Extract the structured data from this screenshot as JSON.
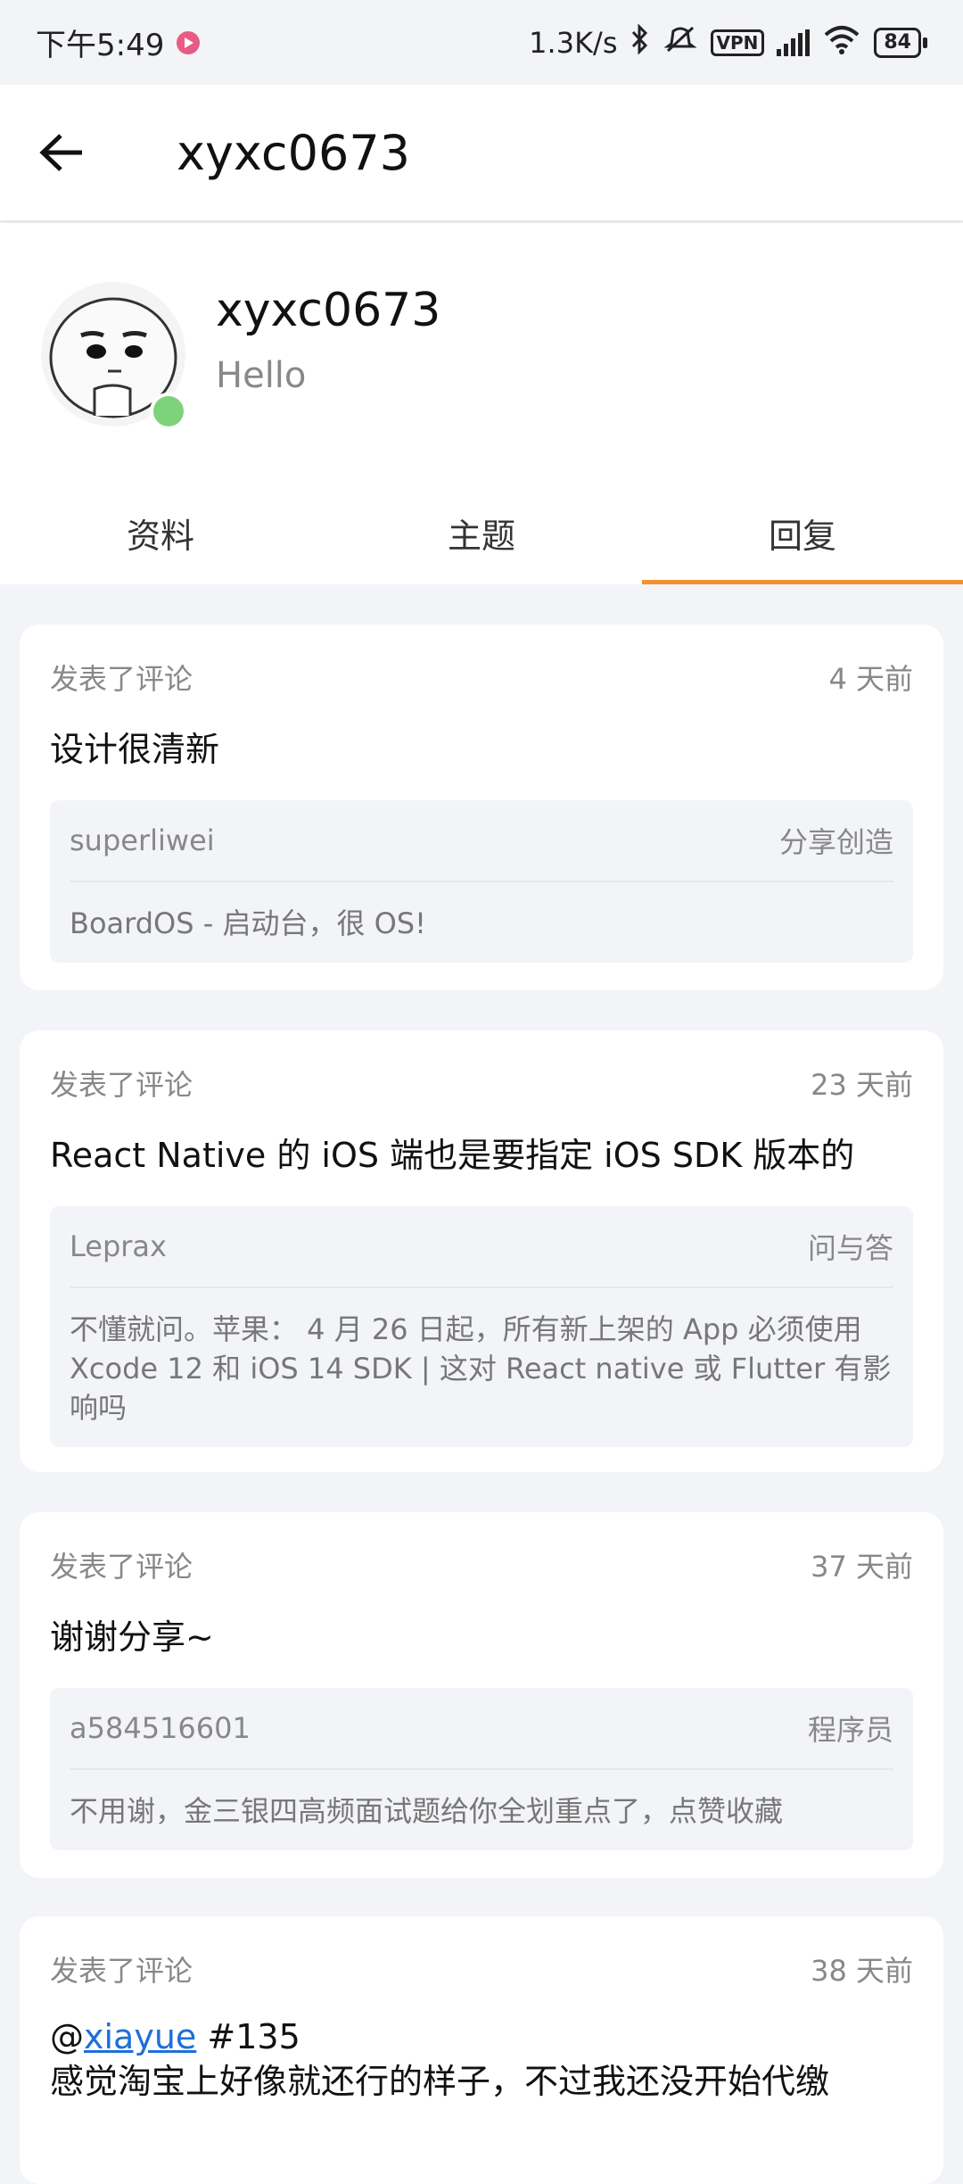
{
  "status_bar": {
    "time": "下午5:49",
    "speed": "1.3K/s",
    "vpn": "VPN",
    "battery": "84"
  },
  "app_bar": {
    "title": "xyxc0673"
  },
  "profile": {
    "username": "xyxc0673",
    "bio": "Hello",
    "online_color": "#7ed37a"
  },
  "tabs": [
    {
      "label": "资料",
      "active": false
    },
    {
      "label": "主题",
      "active": false
    },
    {
      "label": "回复",
      "active": true
    }
  ],
  "accent_color": "#f2922f",
  "replies": [
    {
      "action": "发表了评论",
      "time": "4 天前",
      "content": "设计很清新",
      "quote_author": "superliwei",
      "quote_node": "分享创造",
      "quote_title": "BoardOS - 启动台，很 OS!"
    },
    {
      "action": "发表了评论",
      "time": "23 天前",
      "content": "React Native 的 iOS 端也是要指定 iOS SDK 版本的",
      "quote_author": "Leprax",
      "quote_node": "问与答",
      "quote_title": "不懂就问。苹果： 4 月 26 日起，所有新上架的 App 必须使用 Xcode 12 和 iOS 14 SDK | 这对 React native 或 Flutter 有影响吗"
    },
    {
      "action": "发表了评论",
      "time": "37 天前",
      "content": "谢谢分享~",
      "quote_author": "a584516601",
      "quote_node": "程序员",
      "quote_title": "不用谢，金三银四高频面试题给你全划重点了，点赞收藏"
    },
    {
      "action": "发表了评论",
      "time": "38 天前",
      "content_prefix": "@",
      "mention": "xiayue",
      "content_suffix": " #135",
      "content_line2": "感觉淘宝上好像就还行的样子，不过我还没开始代缴"
    }
  ]
}
